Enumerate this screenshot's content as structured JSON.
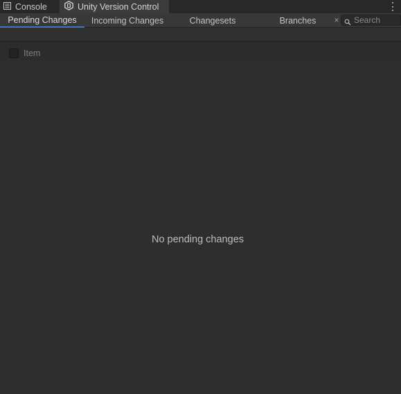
{
  "window_tabs": {
    "console_label": "Console",
    "uvc_label": "Unity Version Control"
  },
  "sub_tabs": [
    {
      "label": "Pending Changes"
    },
    {
      "label": "Incoming Changes"
    },
    {
      "label": "Changesets"
    },
    {
      "label": "Branches"
    }
  ],
  "search": {
    "placeholder": "Search",
    "clear_glyph": "×"
  },
  "list_header": {
    "item_label": "Item"
  },
  "empty_state": {
    "message": "No pending changes"
  },
  "icons": {
    "console": "console-icon",
    "uvc": "unity-version-control-icon",
    "menu": "more-options-icon",
    "search": "search-icon"
  },
  "colors": {
    "active_tab_underline": "#3a79bb",
    "background": "#2e2e2e"
  }
}
